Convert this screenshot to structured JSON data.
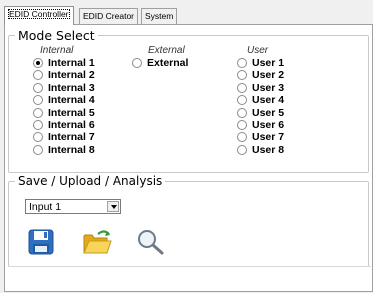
{
  "tabs": [
    {
      "label": "EDID Controller",
      "active": true
    },
    {
      "label": "EDID Creator",
      "active": false
    },
    {
      "label": "System",
      "active": false
    }
  ],
  "mode_select": {
    "title": "Mode Select",
    "internal": {
      "header": "Internal",
      "options": [
        "Internal 1",
        "Internal 2",
        "Internal 3",
        "Internal 4",
        "Internal 5",
        "Internal 6",
        "Internal 7",
        "Internal 8"
      ],
      "selected": "Internal 1"
    },
    "external": {
      "header": "External",
      "options": [
        "External"
      ]
    },
    "user": {
      "header": "User",
      "options": [
        "User 1",
        "User 2",
        "User 3",
        "User 4",
        "User 5",
        "User 6",
        "User 7",
        "User 8"
      ]
    }
  },
  "save_upload": {
    "title": "Save / Upload / Analysis",
    "input_select": {
      "value": "Input 1"
    },
    "buttons": [
      {
        "name": "save",
        "icon": "floppy-disk-icon"
      },
      {
        "name": "open",
        "icon": "open-folder-icon"
      },
      {
        "name": "analyze",
        "icon": "magnifier-icon"
      }
    ]
  },
  "colors": {
    "floppy_blue": "#2f6fc0",
    "folder_yellow": "#f2c230",
    "arrow_green": "#3a9a3a"
  }
}
